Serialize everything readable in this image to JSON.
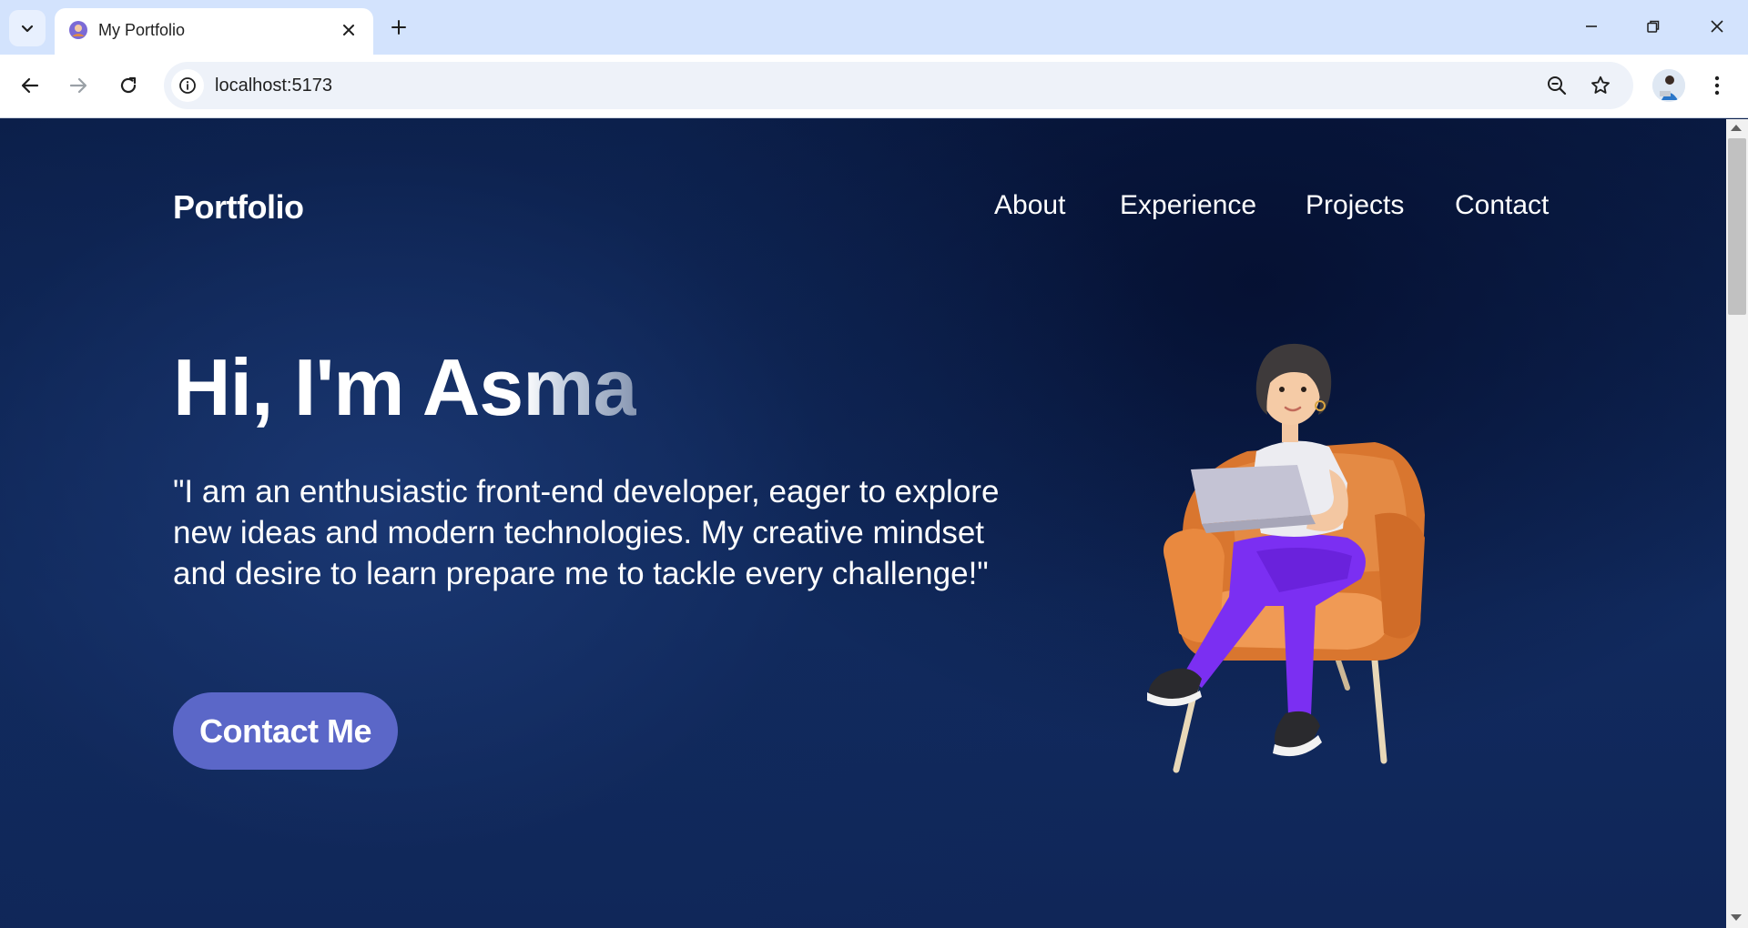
{
  "browser": {
    "tab_title": "My Portfolio",
    "url": "localhost:5173"
  },
  "page": {
    "brand": "Portfolio",
    "nav": [
      "About",
      "Experience",
      "Projects",
      "Contact"
    ],
    "hero": {
      "greeting_start": "Hi, I'm As",
      "greeting_end": "ma",
      "description": "\"I am an enthusiastic front-end developer, eager to explore new ideas and modern technologies. My creative mindset and desire to learn prepare me to tackle every challenge!\"",
      "cta_label": "Contact Me"
    }
  },
  "colors": {
    "tabstrip": "#d3e3fd",
    "page_background": "#0f2350",
    "cta_background": "#5b67c8",
    "chair": "#e08a45",
    "pants": "#7b2ff2"
  },
  "icons": {
    "tab_search": "chevron-down-icon",
    "favicon": "favicon-icon",
    "tab_close": "close-icon",
    "new_tab": "plus-icon",
    "back": "arrow-left-icon",
    "forward": "arrow-right-icon",
    "reload": "reload-icon",
    "site_info": "info-icon",
    "zoom": "zoom-out-icon",
    "bookmark": "star-icon",
    "menu": "kebab-menu-icon"
  }
}
